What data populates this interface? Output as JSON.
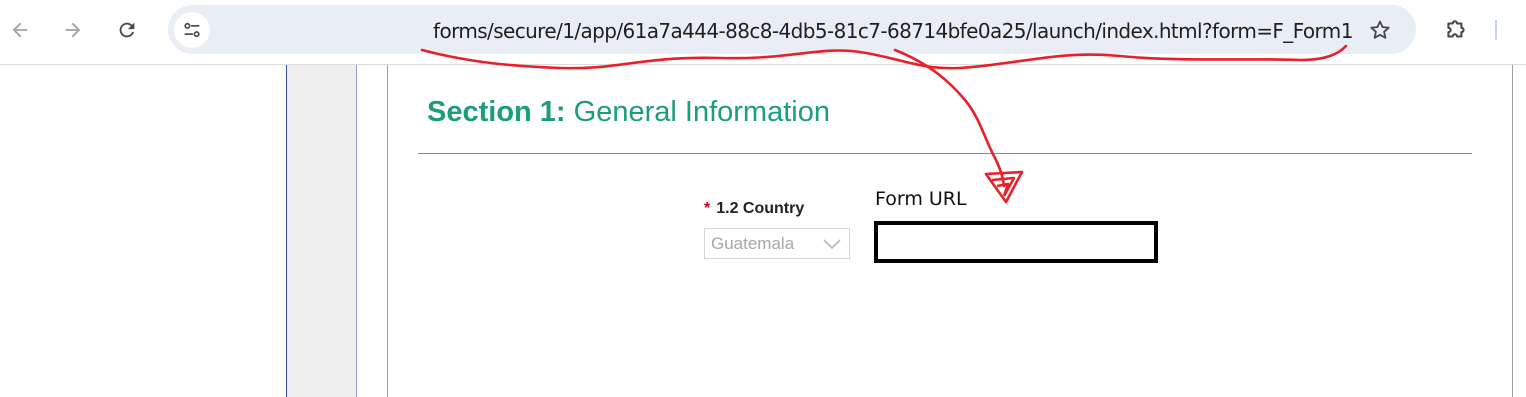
{
  "browser": {
    "url": "forms/secure/1/app/61a7a444-88c8-4db5-81c7-68714bfe0a25/launch/index.html?form=F_Form1...",
    "icons": {
      "back": "arrow-left-icon",
      "forward": "arrow-right-icon",
      "reload": "reload-icon",
      "site_info": "tune-icon",
      "bookmark": "star-icon",
      "extensions": "puzzle-icon"
    }
  },
  "form": {
    "section_number": "Section 1:",
    "section_title": "General Information",
    "country_field": {
      "required_mark": "*",
      "label": "1.2 Country",
      "value": "Guatemala"
    },
    "form_url_field": {
      "label": "Form URL",
      "value": ""
    }
  },
  "colors": {
    "section_title": "#1a9e7e",
    "annotation": "#e8202a",
    "required": "#d0021b"
  }
}
